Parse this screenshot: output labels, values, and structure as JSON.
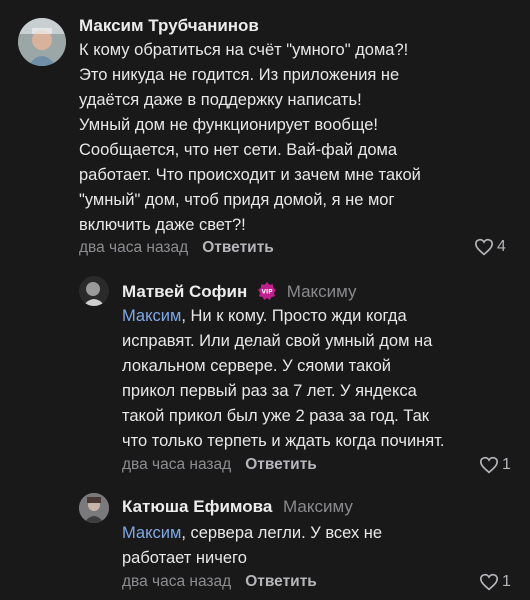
{
  "comments": [
    {
      "author": "Максим Трубчанинов",
      "lines": [
        "К кому обратиться на счёт \"умного\" дома?!",
        "Это никуда не годится. Из приложения не",
        "удаётся даже в поддержку написать!",
        "Умный дом не функционирует вообще!",
        "Сообщается, что нет сети. Вай-фай дома",
        "работает. Что происходит и зачем мне такой",
        "\"умный\" дом, чтоб придя домой, я не мог",
        "включить даже свет?!"
      ],
      "time": "два часа назад",
      "reply_label": "Ответить",
      "likes": "4"
    }
  ],
  "replies": [
    {
      "author": "Матвей Софин",
      "badge": "VIP",
      "reply_to": "Максиму",
      "mention": "Максим",
      "lines": [
        ", Ни к кому. Просто жди когда",
        "исправят. Или делай свой умный дом на",
        "локальном сервере. У сяоми такой",
        "прикол первый раз за 7 лет. У яндекса",
        "такой прикол был уже 2 раза за год. Так",
        "что только терпеть и ждать когда починят."
      ],
      "time": "два часа назад",
      "reply_label": "Ответить",
      "likes": "1"
    },
    {
      "author": "Катюша Ефимова",
      "reply_to": "Максиму",
      "mention": "Максим",
      "lines": [
        ", сервера легли. У всех не",
        "работает ничего"
      ],
      "time": "два часа назад",
      "reply_label": "Ответить",
      "likes": "1"
    }
  ],
  "colors": {
    "background": "#19191a",
    "mention": "#7fa8e6",
    "vip_badge": "#c0208e"
  },
  "icons": {
    "like": "heart-outline-icon",
    "vip": "vip-badge-icon"
  }
}
